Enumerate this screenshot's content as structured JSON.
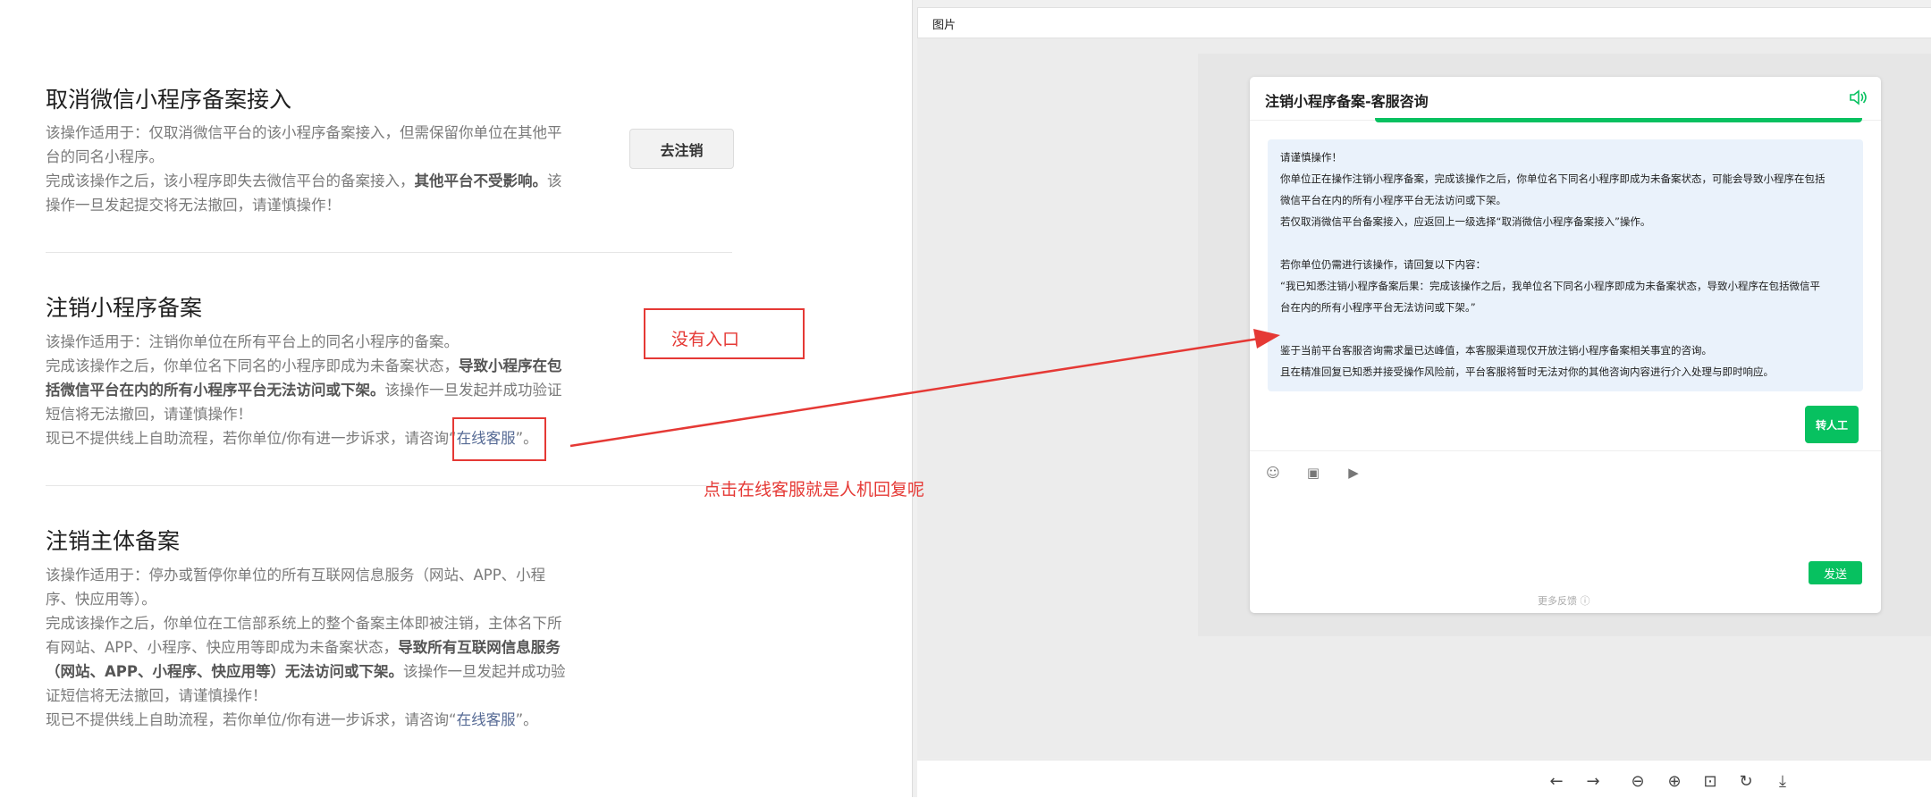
{
  "left": {
    "section1": {
      "title": "取消微信小程序备案接入",
      "p1_l1": "该操作适用于：仅取消微信平台的该小程序备案接入，但需保留你单位在其他平",
      "p1_l2": "台的同名小程序。",
      "p2_l1a": "完成该操作之后，该小程序即失去微信平台的备案接入，",
      "p2_l1b": "其他平台不受影响。",
      "p2_l1c": "该",
      "p2_l2": "操作一旦发起提交将无法撤回，请谨慎操作！",
      "button": "去注销"
    },
    "section2": {
      "title": "注销小程序备案",
      "p1": "该操作适用于：注销你单位在所有平台上的同名小程序的备案。",
      "p2_l1a": "完成该操作之后，你单位名下同名的小程序即成为未备案状态，",
      "p2_l1b": "导致小程序在包",
      "p2_l2a": "括微信平台在内的所有小程序平台无法访问或下架。",
      "p2_l2b": "该操作一旦发起并成功验证",
      "p2_l3": "短信将无法撤回，请谨慎操作！",
      "p3a": "现已不提供线上自助流程，若你单位/你有进一步诉求，请咨询“",
      "p3_link": "在线客服",
      "p3b": "”。"
    },
    "section3": {
      "title": "注销主体备案",
      "p1_l1": "该操作适用于：停办或暂停你单位的所有互联网信息服务（网站、APP、小程",
      "p1_l2": "序、快应用等）。",
      "p2_l1": "完成该操作之后，你单位在工信部系统上的整个备案主体即被注销，主体名下所",
      "p2_l2a": "有网站、APP、小程序、快应用等即成为未备案状态，",
      "p2_l2b": "导致所有互联网信息服务",
      "p2_l3a": "（网站、APP、小程序、快应用等）无法访问或下架。",
      "p2_l3b": "该操作一旦发起并成功验",
      "p2_l4": "证短信将无法撤回，请谨慎操作！",
      "p3a": "现已不提供线上自助流程，若你单位/你有进一步诉求，请咨询“",
      "p3_link": "在线客服",
      "p3b": "”。"
    }
  },
  "annotations": {
    "no_entry": "没有入口",
    "click_note": "点击在线客服就是人机回复呢",
    "color": "#e53935"
  },
  "viewer": {
    "title": "图片",
    "toolbar_icons": [
      "arrow-left-icon",
      "arrow-right-icon",
      "zoom-out-icon",
      "zoom-in-icon",
      "fit-screen-icon",
      "rotate-icon",
      "download-icon"
    ]
  },
  "chat": {
    "title": "注销小程序备案-客服咨询",
    "message_lines": [
      "请谨慎操作！",
      "你单位正在操作注销小程序备案，完成该操作之后，你单位名下同名小程序即成为未备案状态，可能会导致小程序在包括",
      "微信平台在内的所有小程序平台无法访问或下架。",
      "若仅取消微信平台备案接入，应返回上一级选择“取消微信小程序备案接入”操作。",
      "",
      "若你单位仍需进行该操作，请回复以下内容：",
      "“我已知悉注销小程序备案后果：完成该操作之后，我单位名下同名小程序即成为未备案状态，导致小程序在包括微信平",
      "台在内的所有小程序平台无法访问或下架。”",
      "",
      "鉴于当前平台客服咨询需求量已达峰值，本客服渠道现仅开放注销小程序备案相关事宜的咨询。",
      "且在精准回复已知悉并接受操作风险前，平台客服将暂时无法对你的其他咨询内容进行介入处理与即时响应。"
    ],
    "transfer_button": "转人工",
    "send_button": "发送",
    "more_feedback": "更多反馈 ⓘ",
    "accent": "#07c160"
  }
}
